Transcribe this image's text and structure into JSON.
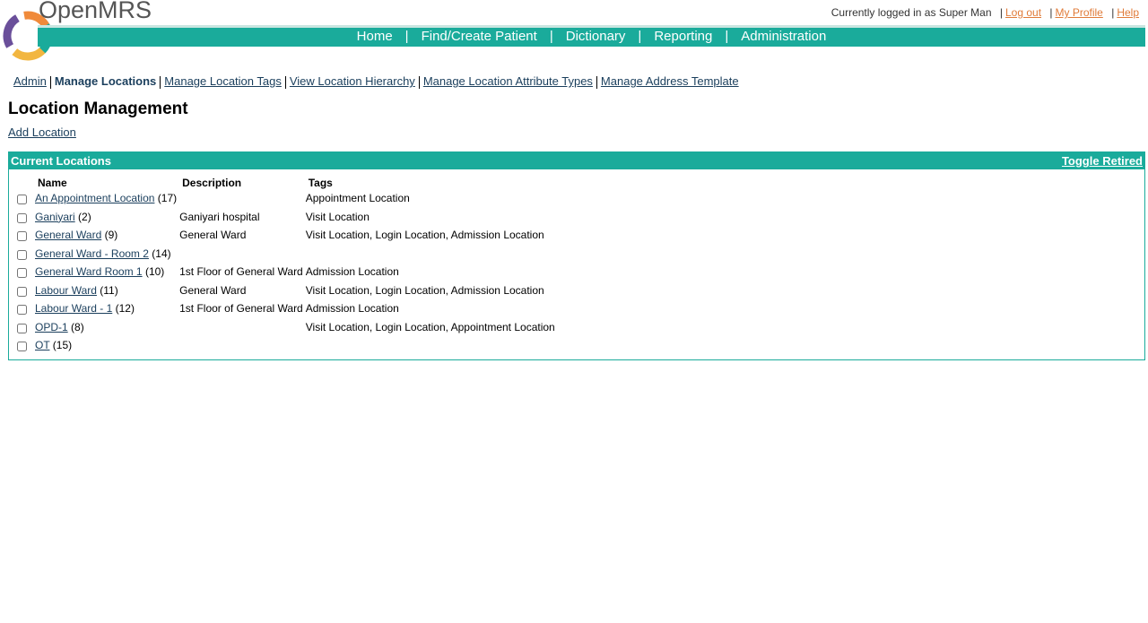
{
  "brand": {
    "name": "OpenMRS"
  },
  "userbar": {
    "status": "Currently logged in as Super Man",
    "logout": "Log out",
    "profile": "My Profile",
    "help": "Help"
  },
  "nav": [
    "Home",
    "Find/Create Patient",
    "Dictionary",
    "Reporting",
    "Administration"
  ],
  "adminbar": [
    "Admin",
    "Manage Locations",
    "Manage Location Tags",
    "View Location Hierarchy",
    "Manage Location Attribute Types",
    "Manage Address Template"
  ],
  "page": {
    "title": "Location Management",
    "add_link": "Add Location"
  },
  "box": {
    "title": "Current Locations",
    "toggle": "Toggle Retired"
  },
  "table": {
    "headers": [
      "Name",
      "Description",
      "Tags"
    ],
    "rows": [
      {
        "name": "An Appointment Location",
        "count": "(17)",
        "description": "",
        "tags": "Appointment Location"
      },
      {
        "name": "Ganiyari",
        "count": "(2)",
        "description": "Ganiyari hospital",
        "tags": "Visit Location"
      },
      {
        "name": "General Ward",
        "count": "(9)",
        "description": "General Ward",
        "tags": "Visit Location, Login Location, Admission Location"
      },
      {
        "name": "General Ward - Room 2",
        "count": "(14)",
        "description": "",
        "tags": ""
      },
      {
        "name": "General Ward Room 1",
        "count": "(10)",
        "description": "1st Floor of General Ward",
        "tags": "Admission Location"
      },
      {
        "name": "Labour Ward",
        "count": "(11)",
        "description": "General Ward",
        "tags": "Visit Location, Login Location, Admission Location"
      },
      {
        "name": "Labour Ward - 1",
        "count": "(12)",
        "description": "1st Floor of General Ward",
        "tags": "Admission Location"
      },
      {
        "name": "OPD-1",
        "count": "(8)",
        "description": "",
        "tags": "Visit Location, Login Location, Appointment Location"
      },
      {
        "name": "OT",
        "count": "(15)",
        "description": "",
        "tags": ""
      }
    ]
  },
  "colors": {
    "accent": "#1aab9b",
    "link": "#1a3e5c",
    "userlink": "#e07b39"
  }
}
